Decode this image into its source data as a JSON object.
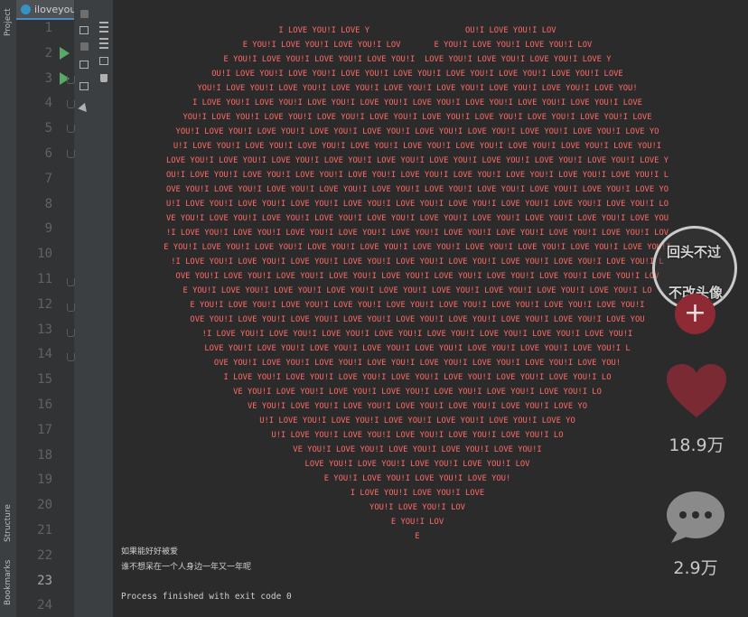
{
  "left_toolbar": {
    "project_label": "Project",
    "structure_label": "Structure",
    "bookmarks_label": "Bookmarks"
  },
  "editor": {
    "tab_name": "iloveyou.ja",
    "line_numbers": [
      "1",
      "2",
      "3",
      "4",
      "5",
      "6",
      "7",
      "8",
      "9",
      "10",
      "11",
      "12",
      "13",
      "14",
      "15",
      "16",
      "17",
      "18",
      "19",
      "20",
      "21",
      "22",
      "23",
      "24"
    ],
    "active_line": "23"
  },
  "console": {
    "heart_lines": [
      "I LOVE YOU!I LOVE Y                    OU!I LOVE YOU!I LOV",
      "E YOU!I LOVE YOU!I LOVE YOU!I LOV       E YOU!I LOVE YOU!I LOVE YOU!I LOV",
      "E YOU!I LOVE YOU!I LOVE YOU!I LOVE YOU!I  LOVE YOU!I LOVE YOU!I LOVE YOU!I LOVE Y",
      "OU!I LOVE YOU!I LOVE YOU!I LOVE YOU!I LOVE YOU!I LOVE YOU!I LOVE YOU!I LOVE YOU!I LOVE",
      "YOU!I LOVE YOU!I LOVE YOU!I LOVE YOU!I LOVE YOU!I LOVE YOU!I LOVE YOU!I LOVE YOU!I LOVE YOU!",
      "I LOVE YOU!I LOVE YOU!I LOVE YOU!I LOVE YOU!I LOVE YOU!I LOVE YOU!I LOVE YOU!I LOVE YOU!I LOVE",
      "YOU!I LOVE YOU!I LOVE YOU!I LOVE YOU!I LOVE YOU!I LOVE YOU!I LOVE YOU!I LOVE YOU!I LOVE YOU!I LOVE",
      "YOU!I LOVE YOU!I LOVE YOU!I LOVE YOU!I LOVE YOU!I LOVE YOU!I LOVE YOU!I LOVE YOU!I LOVE YOU!I LOVE YO",
      "U!I LOVE YOU!I LOVE YOU!I LOVE YOU!I LOVE YOU!I LOVE YOU!I LOVE YOU!I LOVE YOU!I LOVE YOU!I LOVE YOU!I",
      "LOVE YOU!I LOVE YOU!I LOVE YOU!I LOVE YOU!I LOVE YOU!I LOVE YOU!I LOVE YOU!I LOVE YOU!I LOVE YOU!I LOVE Y",
      "OU!I LOVE YOU!I LOVE YOU!I LOVE YOU!I LOVE YOU!I LOVE YOU!I LOVE YOU!I LOVE YOU!I LOVE YOU!I LOVE YOU!I L",
      "OVE YOU!I LOVE YOU!I LOVE YOU!I LOVE YOU!I LOVE YOU!I LOVE YOU!I LOVE YOU!I LOVE YOU!I LOVE YOU!I LOVE YO",
      "U!I LOVE YOU!I LOVE YOU!I LOVE YOU!I LOVE YOU!I LOVE YOU!I LOVE YOU!I LOVE YOU!I LOVE YOU!I LOVE YOU!I LO",
      "VE YOU!I LOVE YOU!I LOVE YOU!I LOVE YOU!I LOVE YOU!I LOVE YOU!I LOVE YOU!I LOVE YOU!I LOVE YOU!I LOVE YOU",
      "!I LOVE YOU!I LOVE YOU!I LOVE YOU!I LOVE YOU!I LOVE YOU!I LOVE YOU!I LOVE YOU!I LOVE YOU!I LOVE YOU!I LOV",
      "E YOU!I LOVE YOU!I LOVE YOU!I LOVE YOU!I LOVE YOU!I LOVE YOU!I LOVE YOU!I LOVE YOU!I LOVE YOU!I LOVE YOU!I",
      "!I LOVE YOU!I LOVE YOU!I LOVE YOU!I LOVE YOU!I LOVE YOU!I LOVE YOU!I LOVE YOU!I LOVE YOU!I LOVE YOU!I L",
      "OVE YOU!I LOVE YOU!I LOVE YOU!I LOVE YOU!I LOVE YOU!I LOVE YOU!I LOVE YOU!I LOVE YOU!I LOVE YOU!I LOV",
      "E YOU!I LOVE YOU!I LOVE YOU!I LOVE YOU!I LOVE YOU!I LOVE YOU!I LOVE YOU!I LOVE YOU!I LOVE YOU!I LO",
      "E YOU!I LOVE YOU!I LOVE YOU!I LOVE YOU!I LOVE YOU!I LOVE YOU!I LOVE YOU!I LOVE YOU!I LOVE YOU!I",
      "OVE YOU!I LOVE YOU!I LOVE YOU!I LOVE YOU!I LOVE YOU!I LOVE YOU!I LOVE YOU!I LOVE YOU!I LOVE YOU",
      "!I LOVE YOU!I LOVE YOU!I LOVE YOU!I LOVE YOU!I LOVE YOU!I LOVE YOU!I LOVE YOU!I LOVE YOU!I",
      "LOVE YOU!I LOVE YOU!I LOVE YOU!I LOVE YOU!I LOVE YOU!I LOVE YOU!I LOVE YOU!I LOVE YOU!I L",
      "OVE YOU!I LOVE YOU!I LOVE YOU!I LOVE YOU!I LOVE YOU!I LOVE YOU!I LOVE YOU!I LOVE YOU!",
      "I LOVE YOU!I LOVE YOU!I LOVE YOU!I LOVE YOU!I LOVE YOU!I LOVE YOU!I LOVE YOU!I LO",
      "VE YOU!I LOVE YOU!I LOVE YOU!I LOVE YOU!I LOVE YOU!I LOVE YOU!I LOVE YOU!I LO",
      "VE YOU!I LOVE YOU!I LOVE YOU!I LOVE YOU!I LOVE YOU!I LOVE YOU!I LOVE YO",
      "U!I LOVE YOU!I LOVE YOU!I LOVE YOU!I LOVE YOU!I LOVE YOU!I LOVE YO",
      "U!I LOVE YOU!I LOVE YOU!I LOVE YOU!I LOVE YOU!I LOVE YOU!I LO",
      "VE YOU!I LOVE YOU!I LOVE YOU!I LOVE YOU!I LOVE YOU!I",
      "LOVE YOU!I LOVE YOU!I LOVE YOU!I LOVE YOU!I LOV",
      "E YOU!I LOVE YOU!I LOVE YOU!I LOVE YOU!",
      "I LOVE YOU!I LOVE YOU!I LOVE",
      "YOU!I LOVE YOU!I LOV",
      "E YOU!I LOV",
      "E"
    ],
    "output_lines": [
      "如果能好好被爱",
      "谁不想呆在一个人身边一年又一年呢"
    ],
    "exit_message": "Process finished with exit code 0"
  },
  "overlay": {
    "avatar_text_top": "回头不过",
    "avatar_text_bottom": "不改头像",
    "follow_label": "+",
    "like_count": "18.9万",
    "comment_count": "2.9万",
    "like_color": "#7a2a33",
    "comment_color": "#8a8a8a"
  }
}
